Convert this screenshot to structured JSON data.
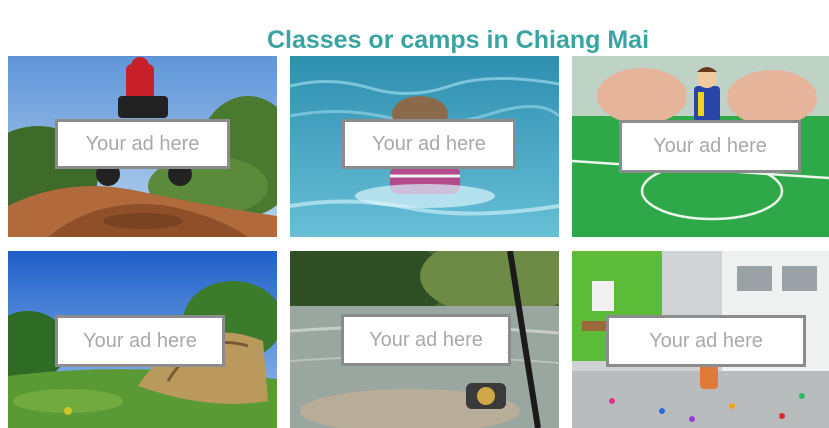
{
  "page": {
    "title": "Classes or camps in Chiang Mai"
  },
  "tiles": [
    {
      "ad_label": "Your ad here",
      "photo": "motocross-rider-jumping-dirt"
    },
    {
      "ad_label": "Your ad here",
      "photo": "child-swimming-in-pool"
    },
    {
      "ad_label": "Your ad here",
      "photo": "hands-playing-toy-football"
    },
    {
      "ad_label": "Your ad here",
      "photo": "tent-camping-on-grass"
    },
    {
      "ad_label": "Your ad here",
      "photo": "fishing-rod-by-river"
    },
    {
      "ad_label": "Your ad here",
      "photo": "child-playing-with-toys-classroom"
    }
  ],
  "colors": {
    "title": "#3aa3a3",
    "ad_border": "#8c8c8c",
    "ad_text": "#a9a9a9",
    "background": "#ffffff"
  }
}
